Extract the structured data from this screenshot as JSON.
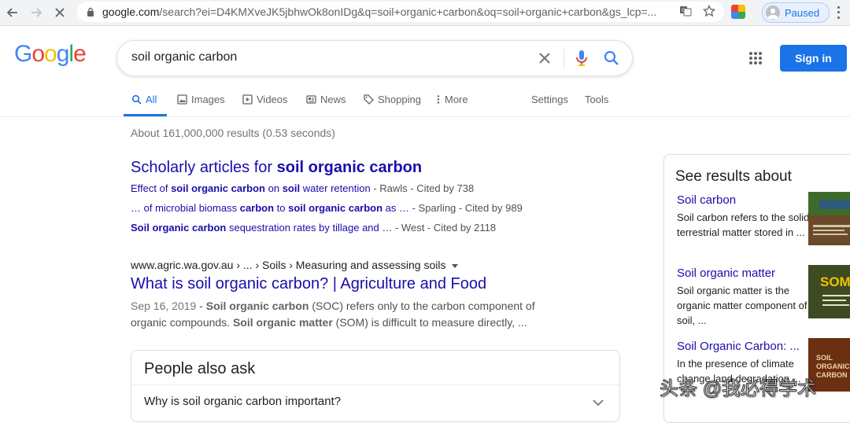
{
  "browser": {
    "url_host": "google.com",
    "url_rest": "/search?ei=D4KMXveJK5jbhwOk8onIDg&q=soil+organic+carbon&oq=soil+organic+carbon&gs_lcp=...",
    "profile_label": "Paused",
    "icons": [
      "back-icon",
      "forward-icon",
      "stop-icon",
      "lock-icon",
      "translate-icon",
      "star-icon",
      "extension-icon",
      "avatar-icon",
      "menu-icon"
    ]
  },
  "header": {
    "logo": "Google",
    "query": "soil organic carbon",
    "signin_label": "Sign in",
    "colors": {
      "blue": "#4285F4",
      "red": "#EA4335",
      "yellow": "#FBBC05",
      "green": "#34A853",
      "link": "#1a0dab",
      "accent": "#1a73e8"
    }
  },
  "tabs": {
    "items": [
      {
        "label": "All",
        "icon": "search-icon"
      },
      {
        "label": "Images",
        "icon": "image-icon"
      },
      {
        "label": "Videos",
        "icon": "video-icon"
      },
      {
        "label": "News",
        "icon": "news-icon"
      },
      {
        "label": "Shopping",
        "icon": "tag-icon"
      },
      {
        "label": "More",
        "icon": "more-vert-icon"
      }
    ],
    "settings_label": "Settings",
    "tools_label": "Tools"
  },
  "results": {
    "stats": "About 161,000,000 results (0.53 seconds)",
    "scholarly": {
      "title_prefix": "Scholarly articles for ",
      "title_bold": "soil organic carbon",
      "lines": [
        {
          "parts": [
            [
              "n",
              "Effect of "
            ],
            [
              "b",
              "soil organic carbon"
            ],
            [
              "n",
              " on "
            ],
            [
              "b",
              "soil"
            ],
            [
              "n",
              " water retention"
            ]
          ],
          "meta": " - Rawls - Cited by 738"
        },
        {
          "parts": [
            [
              "n",
              "… of microbial biomass "
            ],
            [
              "b",
              "carbon"
            ],
            [
              "n",
              " to "
            ],
            [
              "b",
              "soil organic carbon"
            ],
            [
              "n",
              " as …"
            ]
          ],
          "meta": " - Sparling - Cited by 989"
        },
        {
          "parts": [
            [
              "b",
              "Soil organic carbon"
            ],
            [
              "n",
              " sequestration rates by tillage and …"
            ]
          ],
          "meta": " - West - Cited by 2118"
        }
      ]
    },
    "first": {
      "cite": "www.agric.wa.gov.au › ... › Soils › Measuring and assessing soils",
      "title": "What is soil organic carbon? | Agriculture and Food",
      "date": "Sep 16, 2019",
      "dash": " - ",
      "s1_bold": "Soil organic carbon",
      "s1_rest": " (SOC) refers only to the carbon component of organic compounds. ",
      "s2_bold": "Soil organic matter",
      "s2_rest": " (SOM) is difficult to measure directly, ..."
    },
    "paa": {
      "heading": "People also ask",
      "question": "Why is soil organic carbon important?"
    }
  },
  "panel": {
    "heading": "See results about",
    "items": [
      {
        "title": "Soil carbon",
        "desc": "Soil carbon refers to the solid terrestrial matter stored in ..."
      },
      {
        "title": "Soil organic matter",
        "desc": "Soil organic matter is the organic matter component of soil, ..."
      },
      {
        "title": "Soil Organic Carbon: ...",
        "desc": "In the presence of climate change land degradation ..."
      }
    ],
    "thumb_texts": [
      "SOM",
      "SOIL ORGANIC CARBON"
    ]
  },
  "watermark": "头条 @我必得学术"
}
